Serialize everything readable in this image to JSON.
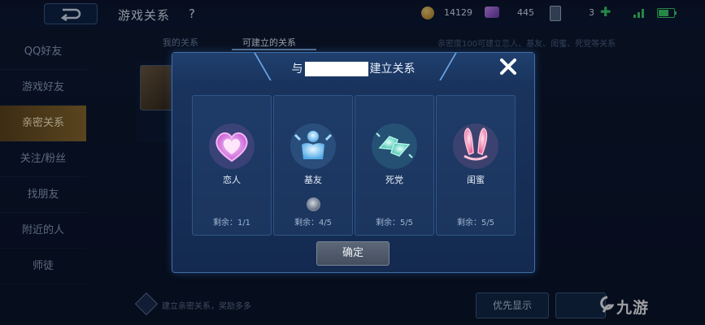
{
  "topbar": {
    "title": "游戏关系",
    "help": "?",
    "coins": "14129",
    "gems": "445",
    "cards": "3"
  },
  "sidebar": {
    "items": [
      {
        "label": "QQ好友"
      },
      {
        "label": "游戏好友"
      },
      {
        "label": "亲密关系",
        "active": true
      },
      {
        "label": "关注/粉丝"
      },
      {
        "label": "找朋友"
      },
      {
        "label": "附近的人"
      },
      {
        "label": "师徒"
      }
    ]
  },
  "tabs": [
    {
      "label": "我的关系"
    },
    {
      "label": "可建立的关系",
      "active": true
    }
  ],
  "hint_top": "亲密度100可建立恋人、基友、闺蜜、死党等关系",
  "footer": {
    "hint": "建立亲密关系，奖励多多",
    "priority_label": "优先显示"
  },
  "watermark": "九游",
  "modal": {
    "title_prefix": "与",
    "title_suffix": "建立关系",
    "confirm_label": "确定",
    "cards": [
      {
        "name": "恋人",
        "remaining": "剩余：1/1",
        "icon": "heart-icon",
        "color": "#e58be6"
      },
      {
        "name": "基友",
        "remaining": "剩余：4/5",
        "icon": "buddy-icon",
        "color": "#7fc8f2"
      },
      {
        "name": "死党",
        "remaining": "剩余：5/5",
        "icon": "fist-bump-icon",
        "color": "#59d9c4"
      },
      {
        "name": "闺蜜",
        "remaining": "剩余：5/5",
        "icon": "bunny-ears-icon",
        "color": "#f07ab0"
      }
    ]
  },
  "colors": {
    "accent": "#3f6ea8",
    "active_sidebar": "#8a6a2e"
  }
}
